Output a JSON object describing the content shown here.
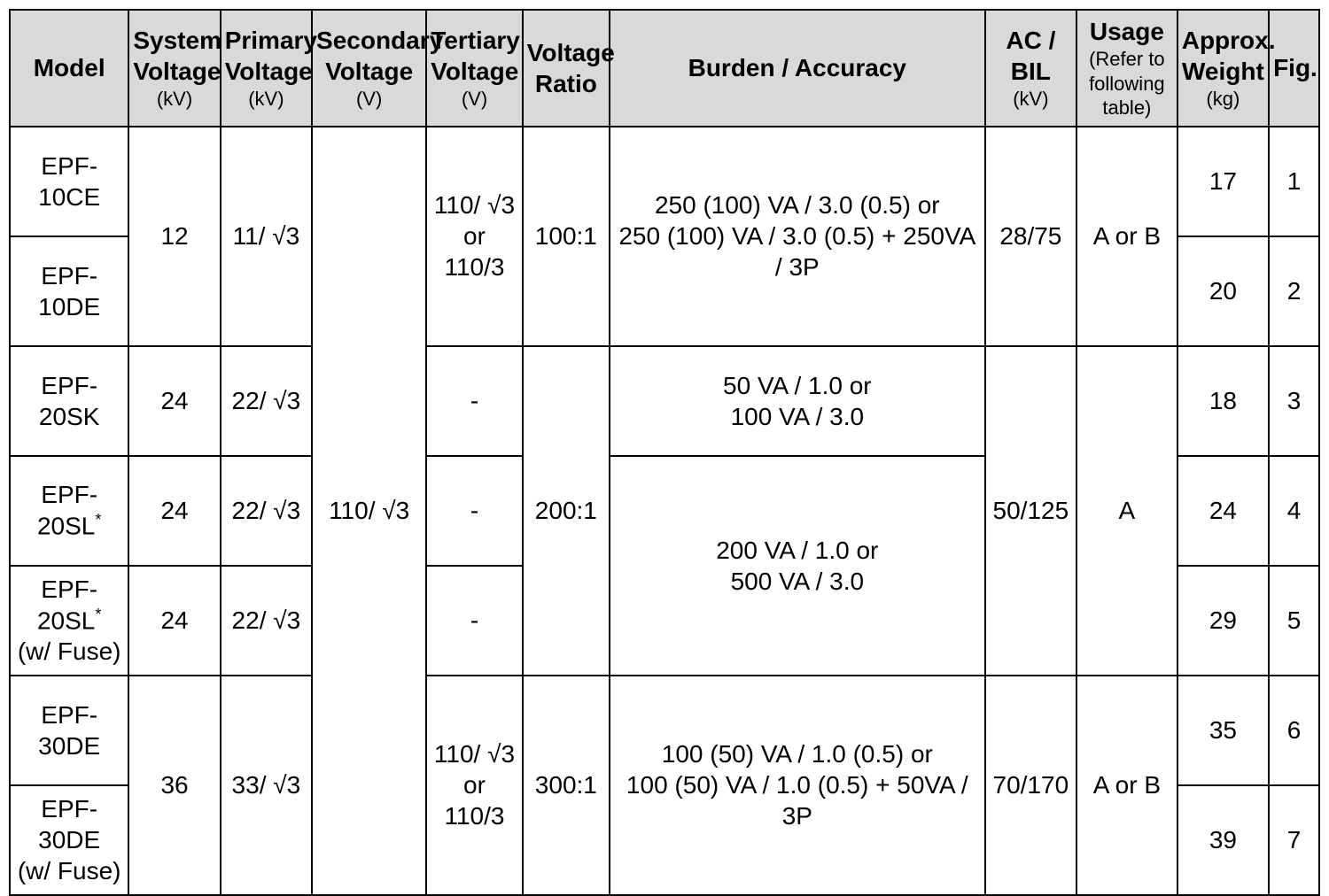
{
  "chart_data": {
    "type": "table",
    "headers": [
      {
        "main": "Model",
        "sub": ""
      },
      {
        "main": "System Voltage",
        "sub": "(kV)"
      },
      {
        "main": "Primary Voltage",
        "sub": "(kV)"
      },
      {
        "main": "Secondary Voltage",
        "sub": "(V)"
      },
      {
        "main": "Tertiary Voltage",
        "sub": "(V)"
      },
      {
        "main": "Voltage Ratio",
        "sub": ""
      },
      {
        "main": "Burden / Accuracy",
        "sub": ""
      },
      {
        "main": "AC / BIL",
        "sub": "(kV)"
      },
      {
        "main": "Usage",
        "sub": "(Refer to following table)"
      },
      {
        "main": "Approx. Weight",
        "sub": "(kg)"
      },
      {
        "main": "Fig.",
        "sub": ""
      }
    ],
    "secondary_voltage_all": "110/ √3",
    "groups": [
      {
        "system_voltage": "12",
        "primary_voltage": "11/ √3",
        "tertiary_voltage": "110/ √3\nor\n110/3",
        "voltage_ratio": "100:1",
        "burden_accuracy": "250 (100) VA / 3.0 (0.5) or\n250 (100) VA / 3.0 (0.5) + 250VA / 3P",
        "ac_bil": "28/75",
        "usage": "A or B",
        "rows": [
          {
            "model": "EPF-10CE",
            "weight": "17",
            "fig": "1"
          },
          {
            "model": "EPF-10DE",
            "weight": "20",
            "fig": "2"
          }
        ]
      },
      {
        "voltage_ratio": "200:1",
        "ac_bil": "50/125",
        "usage": "A",
        "rows": [
          {
            "model": "EPF-20SK",
            "system_voltage": "24",
            "primary_voltage": "22/ √3",
            "tertiary_voltage": "-",
            "burden_accuracy": "50 VA / 1.0 or\n100 VA / 3.0",
            "weight": "18",
            "fig": "3"
          },
          {
            "model": "EPF-20SL*",
            "system_voltage": "24",
            "primary_voltage": "22/ √3",
            "tertiary_voltage": "-",
            "burden_accuracy": "200 VA / 1.0 or\n500 VA / 3.0",
            "weight": "24",
            "fig": "4"
          },
          {
            "model": "EPF-20SL*\n(w/ Fuse)",
            "system_voltage": "24",
            "primary_voltage": "22/ √3",
            "tertiary_voltage": "-",
            "weight": "29",
            "fig": "5"
          }
        ]
      },
      {
        "system_voltage": "36",
        "primary_voltage": "33/ √3",
        "tertiary_voltage": "110/ √3\nor\n110/3",
        "voltage_ratio": "300:1",
        "burden_accuracy": "100 (50) VA / 1.0 (0.5) or\n100 (50) VA / 1.0 (0.5) + 50VA / 3P",
        "ac_bil": "70/170",
        "usage": "A or B",
        "rows": [
          {
            "model": "EPF-30DE",
            "weight": "35",
            "fig": "6"
          },
          {
            "model": "EPF-30DE\n(w/ Fuse)",
            "weight": "39",
            "fig": "7"
          }
        ]
      }
    ]
  }
}
